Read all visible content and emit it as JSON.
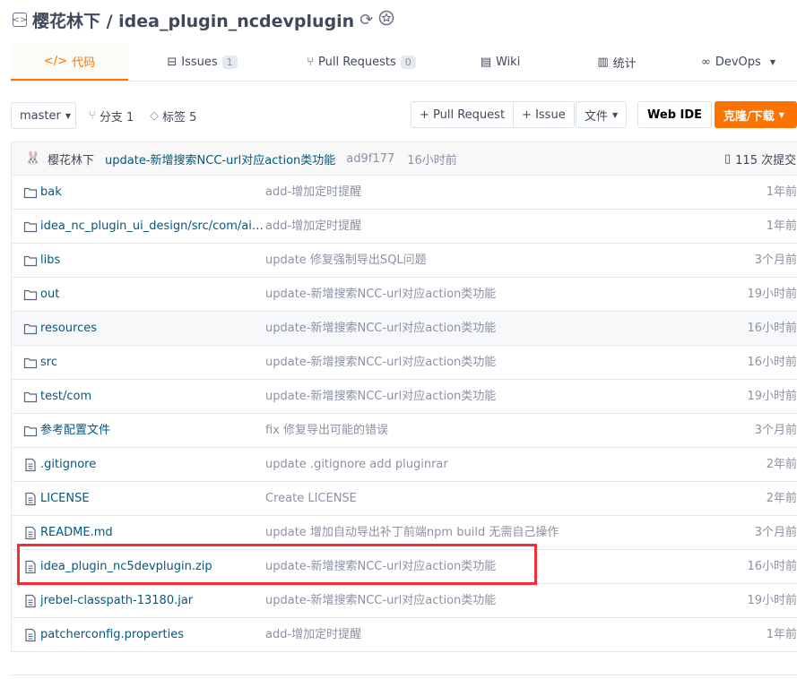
{
  "repo": {
    "title": "樱花林下 / idea_plugin_ncdevplugin"
  },
  "tabs": [
    {
      "label": "代码",
      "icon": "code-icon"
    },
    {
      "label": "Issues",
      "count": "1",
      "icon": "issues-icon"
    },
    {
      "label": "Pull Requests",
      "count": "0",
      "icon": "pull-request-icon"
    },
    {
      "label": "Wiki",
      "icon": "wiki-icon"
    },
    {
      "label": "统计",
      "icon": "stats-icon"
    },
    {
      "label": "DevOps",
      "icon": "devops-icon"
    }
  ],
  "toolbar": {
    "branch": "master",
    "branches": "分支 1",
    "tags": "标签 5",
    "pull_request": "+ Pull Request",
    "issue": "+ Issue",
    "file": "文件",
    "web_ide": "Web IDE",
    "clone": "克隆/下载"
  },
  "commit": {
    "author": "樱花林下",
    "message": "update-新增搜索NCC-url对应action类功能",
    "hash": "ad9f177",
    "time": "16小时前",
    "count": "115 次提交"
  },
  "files": [
    {
      "type": "folder",
      "name": "bak",
      "message": "add-增加定时提醒",
      "time": "1年前"
    },
    {
      "type": "folder",
      "name": "idea_nc_plugin_ui_design/src/com/air/i...",
      "message": "add-增加定时提醒",
      "time": "1年前"
    },
    {
      "type": "folder",
      "name": "libs",
      "message": "update 修复强制导出SQL问题",
      "time": "3个月前"
    },
    {
      "type": "folder",
      "name": "out",
      "message": "update-新增搜索NCC-url对应action类功能",
      "time": "19小时前"
    },
    {
      "type": "folder",
      "name": "resources",
      "message": "update-新增搜索NCC-url对应action类功能",
      "time": "16小时前"
    },
    {
      "type": "folder",
      "name": "src",
      "message": "update-新增搜索NCC-url对应action类功能",
      "time": "16小时前"
    },
    {
      "type": "folder",
      "name": "test/com",
      "message": "update-新增搜索NCC-url对应action类功能",
      "time": "19小时前"
    },
    {
      "type": "folder",
      "name": "参考配置文件",
      "message": "fix 修复导出可能的错误",
      "time": "3个月前"
    },
    {
      "type": "file",
      "name": ".gitignore",
      "message": "update .gitignore add pluginrar",
      "time": "2年前"
    },
    {
      "type": "file",
      "name": "LICENSE",
      "message": "Create LICENSE",
      "time": "2年前"
    },
    {
      "type": "file",
      "name": "README.md",
      "message": "update 增加自动导出补丁前端npm build 无需自己操作",
      "time": "3个月前"
    },
    {
      "type": "file",
      "name": "idea_plugin_nc5devplugin.zip",
      "message": "update-新增搜索NCC-url对应action类功能",
      "time": "16小时前"
    },
    {
      "type": "file",
      "name": "jrebel-classpath-13180.jar",
      "message": "update-新增搜索NCC-url对应action类功能",
      "time": "19小时前"
    },
    {
      "type": "file",
      "name": "patcherconfig.properties",
      "message": "add-增加定时提醒",
      "time": "1年前"
    }
  ],
  "colors": {
    "accent": "#fe7300",
    "link": "#005980",
    "muted": "#8c92a4",
    "highlight_box": "#ef2e3a"
  }
}
